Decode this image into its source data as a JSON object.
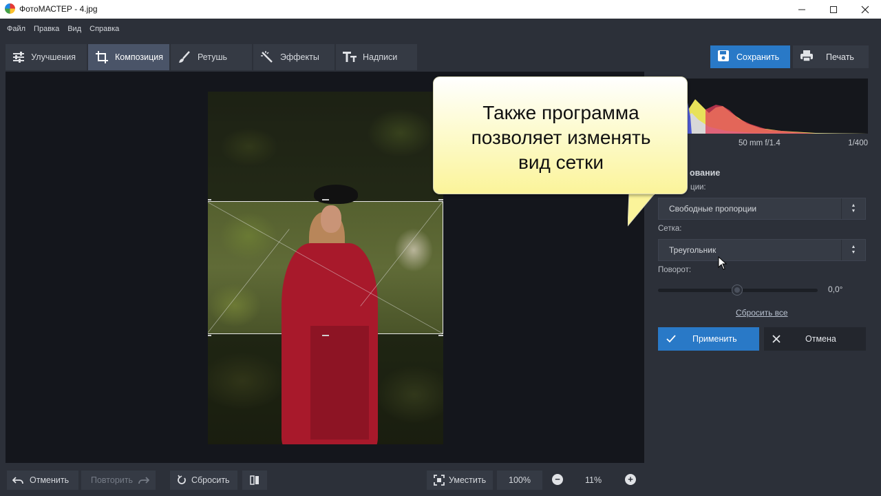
{
  "window": {
    "title": "ФотоМАСТЕР - 4.jpg"
  },
  "menu": [
    "Файл",
    "Правка",
    "Вид",
    "Справка"
  ],
  "tabs": [
    {
      "label": "Улучшения",
      "icon": "sliders-icon"
    },
    {
      "label": "Композиция",
      "icon": "crop-icon",
      "active": true
    },
    {
      "label": "Ретушь",
      "icon": "brush-icon"
    },
    {
      "label": "Эффекты",
      "icon": "magic-wand-icon"
    },
    {
      "label": "Надписи",
      "icon": "text-icon"
    }
  ],
  "toolbar": {
    "save_label": "Сохранить",
    "print_label": "Печать"
  },
  "histogram": {
    "lens": "50 mm f/1.4",
    "shutter": "1/400"
  },
  "panel": {
    "section_title": "ование",
    "proportions_label": "ции:",
    "proportions_value": "Свободные пропорции",
    "grid_label": "Сетка:",
    "grid_value": "Треугольник",
    "rotation_label": "Поворот:",
    "rotation_value": "0,0°",
    "reset_all": "Сбросить все",
    "apply_label": "Применить",
    "cancel_label": "Отмена"
  },
  "callout": {
    "lines": [
      "Также программа",
      "позволяет изменять",
      "вид сетки"
    ]
  },
  "bottom": {
    "undo": "Отменить",
    "redo": "Повторить",
    "reset": "Сбросить",
    "fit": "Уместить",
    "zoom_100": "100%",
    "zoom_current": "11%"
  },
  "colors": {
    "accent": "#2979c7",
    "panel": "#2c3039",
    "canvas": "#14161c"
  }
}
